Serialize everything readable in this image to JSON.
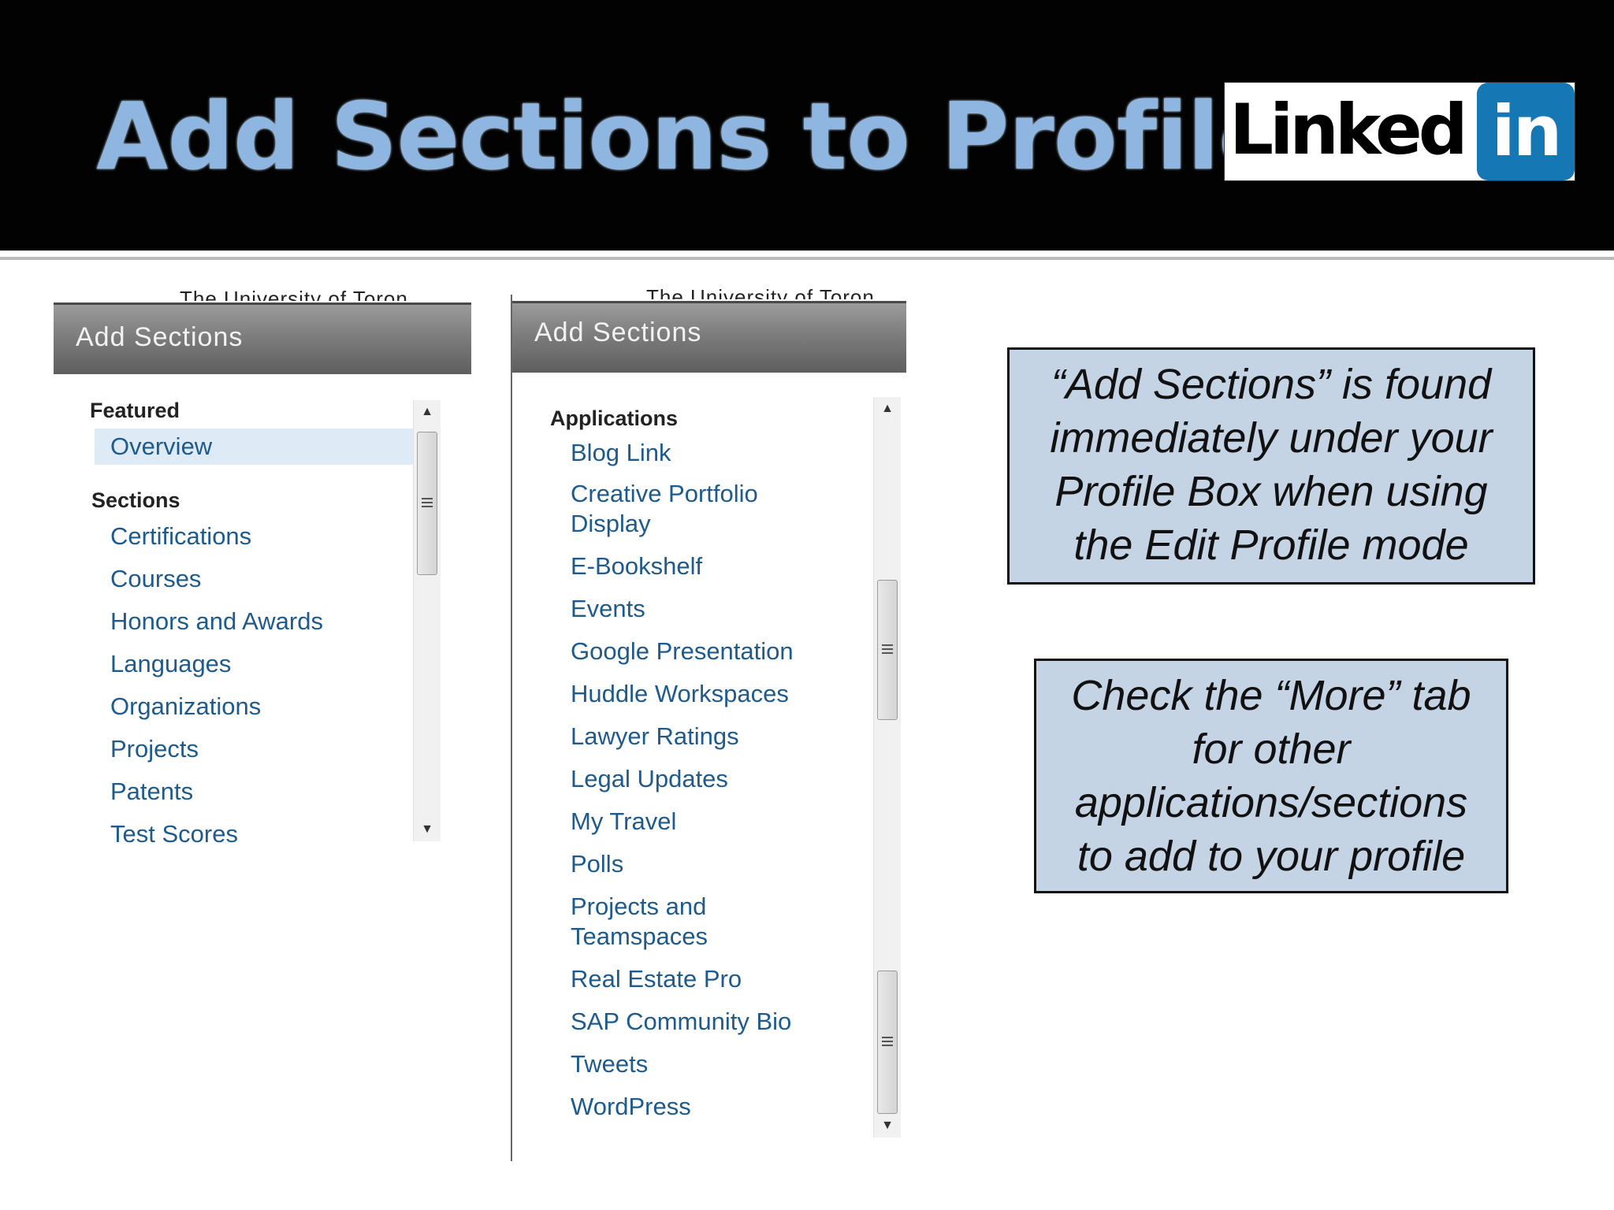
{
  "header": {
    "title": "Add Sections to Profile",
    "logo": {
      "text": "Linked",
      "badge": "in",
      "brand_color": "#1677b5"
    }
  },
  "left_panel": {
    "cut_text": "The University of Toron",
    "header": "Add Sections",
    "groups": [
      {
        "label": "Featured",
        "items": [
          "Overview"
        ]
      },
      {
        "label": "Sections",
        "items": [
          "Certifications",
          "Courses",
          "Honors and Awards",
          "Languages",
          "Organizations",
          "Projects",
          "Patents",
          "Test Scores"
        ]
      }
    ],
    "highlighted_item": "Overview"
  },
  "right_panel": {
    "cut_text": "The University of Toron",
    "header": "Add Sections",
    "groups": [
      {
        "label": "Applications",
        "items": [
          "Blog Link",
          "Creative Portfolio Display",
          "E-Bookshelf",
          "Events",
          "Google Presentation",
          "Huddle Workspaces",
          "Lawyer Ratings",
          "Legal Updates",
          "My Travel",
          "Polls",
          "Projects and Teamspaces",
          "Real Estate Pro",
          "SAP Community Bio",
          "Tweets",
          "WordPress"
        ]
      }
    ]
  },
  "callouts": [
    {
      "lines": [
        "“Add Sections” is found",
        "immediately under your",
        "Profile Box when using",
        "the Edit Profile mode"
      ]
    },
    {
      "lines": [
        "Check the “More” tab",
        "for other",
        "applications/sections",
        "to add to your profile"
      ]
    }
  ],
  "colors": {
    "header_bg": "#020202",
    "title": "#8fb6e0",
    "link": "#1e5b8c",
    "callout_bg": "#c4d4e4"
  }
}
